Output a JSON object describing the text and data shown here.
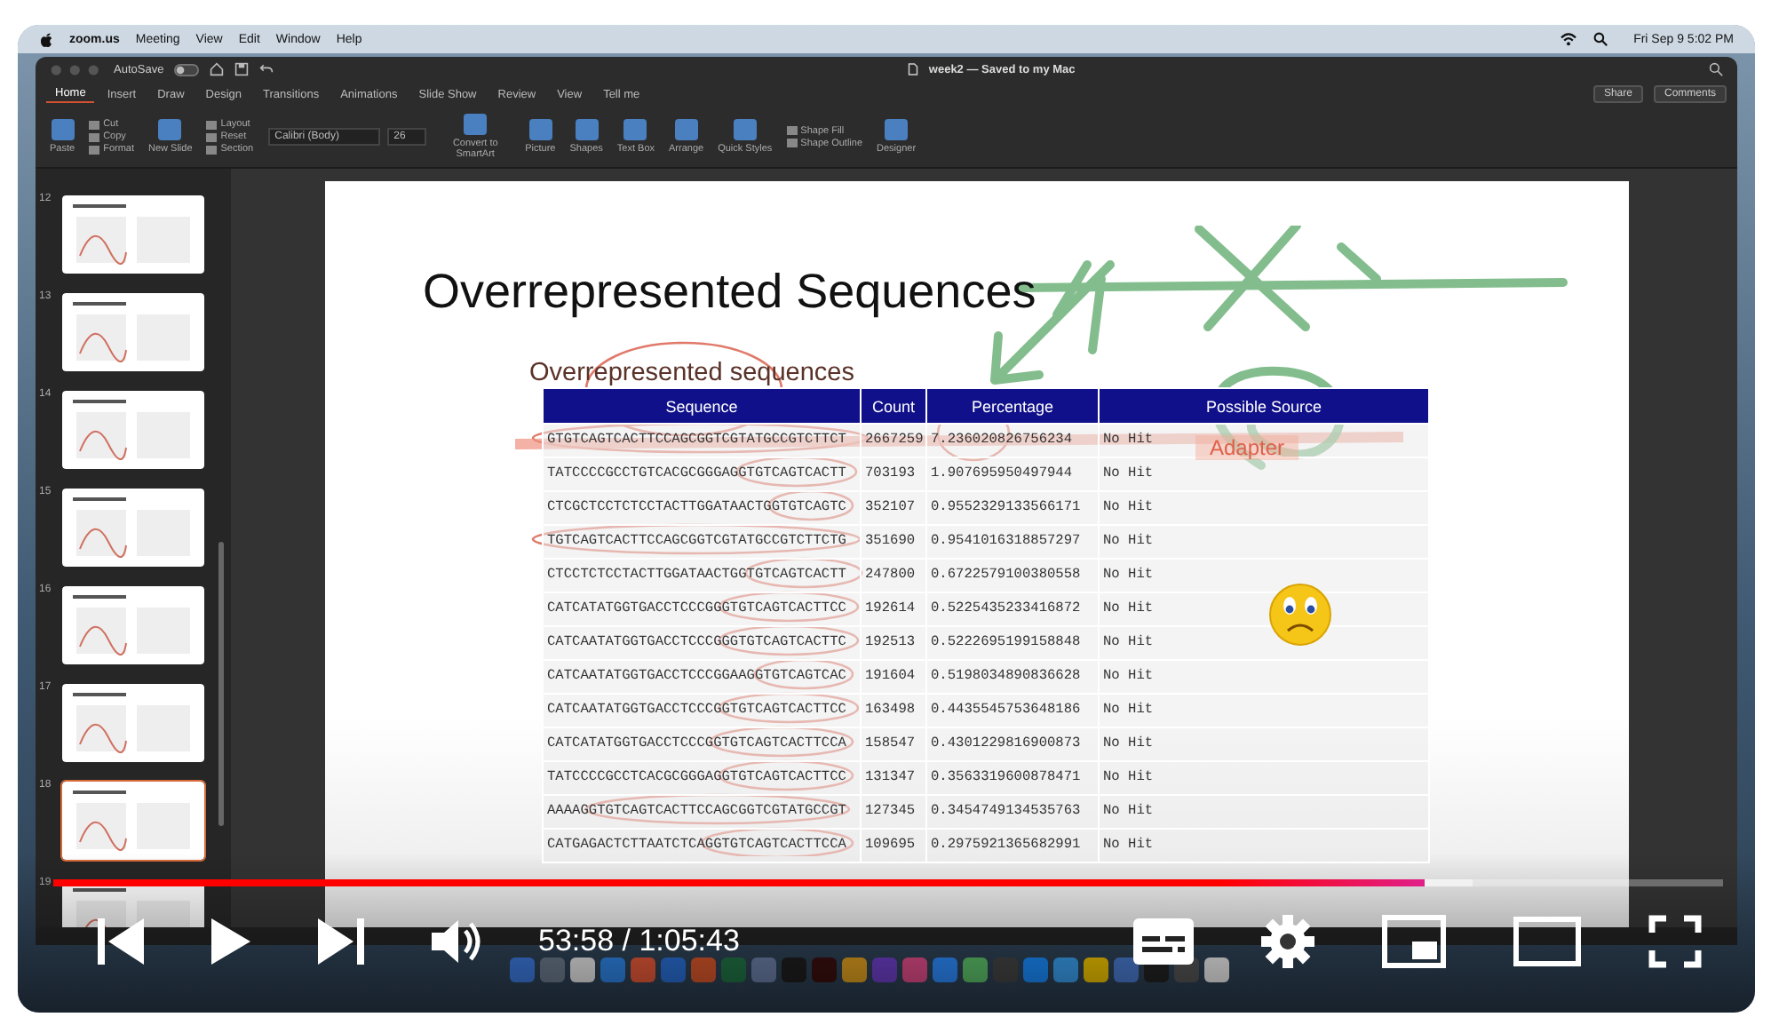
{
  "menubar": {
    "app": "zoom.us",
    "items": [
      "Meeting",
      "View",
      "Edit",
      "Window",
      "Help"
    ],
    "clock": "Fri Sep 9  5:02 PM"
  },
  "powerpoint": {
    "autosave": "AutoSave",
    "title": "week2 — Saved to my Mac",
    "tabs": [
      {
        "label": "Home",
        "selected": true
      },
      {
        "label": "Insert",
        "selected": false
      },
      {
        "label": "Draw",
        "selected": false
      },
      {
        "label": "Design",
        "selected": false
      },
      {
        "label": "Transitions",
        "selected": false
      },
      {
        "label": "Animations",
        "selected": false
      },
      {
        "label": "Slide Show",
        "selected": false
      },
      {
        "label": "Review",
        "selected": false
      },
      {
        "label": "View",
        "selected": false
      },
      {
        "label": "Tell me",
        "selected": false
      }
    ],
    "share": "Share",
    "comments": "Comments",
    "ribbon": [
      {
        "kind": "large",
        "label": "Paste"
      },
      {
        "kind": "stack",
        "labels": [
          "Cut",
          "Copy",
          "Format"
        ]
      },
      {
        "kind": "large",
        "label": "New Slide"
      },
      {
        "kind": "stack",
        "labels": [
          "Layout",
          "Reset",
          "Section"
        ]
      },
      {
        "kind": "font",
        "font": "Calibri (Body)",
        "size": "26"
      },
      {
        "kind": "large",
        "label": "Convert to SmartArt"
      },
      {
        "kind": "large",
        "label": "Picture"
      },
      {
        "kind": "large",
        "label": "Shapes"
      },
      {
        "kind": "large",
        "label": "Text Box"
      },
      {
        "kind": "large",
        "label": "Arrange"
      },
      {
        "kind": "large",
        "label": "Quick Styles"
      },
      {
        "kind": "stack",
        "labels": [
          "Shape Fill",
          "Shape Outline"
        ]
      },
      {
        "kind": "large",
        "label": "Designer"
      }
    ]
  },
  "slides_panel": [
    {
      "number": "12",
      "selected": false
    },
    {
      "number": "13",
      "selected": false
    },
    {
      "number": "14",
      "selected": false
    },
    {
      "number": "15",
      "selected": false
    },
    {
      "number": "16",
      "selected": false
    },
    {
      "number": "17",
      "selected": false
    },
    {
      "number": "18",
      "selected": true
    },
    {
      "number": "19",
      "selected": false
    }
  ],
  "slide": {
    "title": "Overrepresented Sequences",
    "table_title": "Overrepresented sequences",
    "columns": [
      "Sequence",
      "Count",
      "Percentage",
      "Possible Source"
    ],
    "rows": [
      [
        "GTGTCAGTCACTTCCAGCGGTCGTATGCCGTCTTCT",
        "2667259",
        "7.236020826756234",
        "No Hit"
      ],
      [
        "TATCCCCGCCTGTCACGCGGGAGGTGTCAGTCACTT",
        "703193",
        "1.907695950497944",
        "No Hit"
      ],
      [
        "CTCGCTCCTCTCCTACTTGGATAACTGGTGTCAGTC",
        "352107",
        "0.9552329133566171",
        "No Hit"
      ],
      [
        "TGTCAGTCACTTCCAGCGGTCGTATGCCGTCTTCTG",
        "351690",
        "0.9541016318857297",
        "No Hit"
      ],
      [
        "CTCCTCTCCTACTTGGATAACTGGTGTCAGTCACTT",
        "247800",
        "0.6722579100380558",
        "No Hit"
      ],
      [
        "CATCATATGGTGACCTCCCGGGTGTCAGTCACTTCC",
        "192614",
        "0.5225435233416872",
        "No Hit"
      ],
      [
        "CATCAATATGGTGACCTCCCGGGTGTCAGTCACTTC",
        "192513",
        "0.5222695199158848",
        "No Hit"
      ],
      [
        "CATCAATATGGTGACCTCCCGGAAGGTGTCAGTCAC",
        "191604",
        "0.5198034890836628",
        "No Hit"
      ],
      [
        "CATCAATATGGTGACCTCCCGGTGTCAGTCACTTCC",
        "163498",
        "0.4435545753648186",
        "No Hit"
      ],
      [
        "CATCATATGGTGACCTCCCGGTGTCAGTCACTTCCA",
        "158547",
        "0.4301229816900873",
        "No Hit"
      ],
      [
        "TATCCCCGCCTCACGCGGGAGGTGTCAGTCACTTCC",
        "131347",
        "0.3563319600878471",
        "No Hit"
      ],
      [
        "AAAAGGTGTCAGTCACTTCCAGCGGTCGTATGCCGT",
        "127345",
        "0.3454749134535763",
        "No Hit"
      ],
      [
        "CATGAGACTCTTAATCTCAGGTGTCAGTCACTTCCA",
        "109695",
        "0.2975921365682991",
        "No Hit"
      ]
    ],
    "annotation": "Adapter"
  },
  "player": {
    "time": "53:58 / 1:05:43",
    "level": 0.821
  }
}
